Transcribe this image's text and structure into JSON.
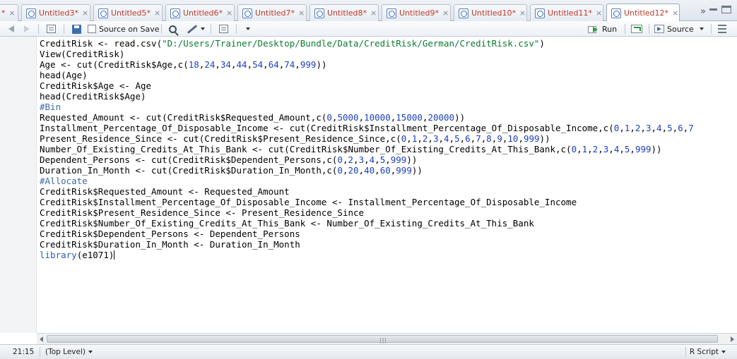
{
  "tabs": [
    {
      "label": "*",
      "close": "×"
    },
    {
      "label": "Untitled3*",
      "close": "×"
    },
    {
      "label": "Untitled5*",
      "close": "×"
    },
    {
      "label": "Untitled6*",
      "close": "×"
    },
    {
      "label": "Untitled7*",
      "close": "×"
    },
    {
      "label": "Untitled8*",
      "close": "×"
    },
    {
      "label": "Untitled9*",
      "close": "×"
    },
    {
      "label": "Untitled10*",
      "close": "×"
    },
    {
      "label": "Untitled11*",
      "close": "×"
    },
    {
      "label": "Untitled12*",
      "close": "×"
    }
  ],
  "active_tab": "Untitled12*",
  "tab_overflow": "»",
  "toolbar": {
    "source_on_save": "Source on Save",
    "run": "Run",
    "source": "Source"
  },
  "code_lines": [
    {
      "n": "1",
      "segs": [
        {
          "t": "CreditRisk <- read.csv("
        },
        {
          "t": "\"D:/Users/Trainer/Desktop/Bundle/Data/CreditRisk/German/CreditRisk.csv\"",
          "c": "st"
        },
        {
          "t": ")"
        }
      ]
    },
    {
      "n": "2",
      "segs": [
        {
          "t": "View(CreditRisk)"
        }
      ]
    },
    {
      "n": "3",
      "segs": [
        {
          "t": "Age <- cut(CreditRisk$Age,c("
        },
        {
          "t": "18",
          "c": "nm"
        },
        {
          "t": ","
        },
        {
          "t": "24",
          "c": "nm"
        },
        {
          "t": ","
        },
        {
          "t": "34",
          "c": "nm"
        },
        {
          "t": ","
        },
        {
          "t": "44",
          "c": "nm"
        },
        {
          "t": ","
        },
        {
          "t": "54",
          "c": "nm"
        },
        {
          "t": ","
        },
        {
          "t": "64",
          "c": "nm"
        },
        {
          "t": ","
        },
        {
          "t": "74",
          "c": "nm"
        },
        {
          "t": ","
        },
        {
          "t": "999",
          "c": "nm"
        },
        {
          "t": "))"
        }
      ]
    },
    {
      "n": "4",
      "segs": [
        {
          "t": "head(Age)"
        }
      ]
    },
    {
      "n": "5",
      "segs": [
        {
          "t": "CreditRisk$Age <- Age"
        }
      ]
    },
    {
      "n": "6",
      "segs": [
        {
          "t": "head(CreditRisk$Age)"
        }
      ]
    },
    {
      "n": "7",
      "segs": [
        {
          "t": "#Bin",
          "c": "cm"
        }
      ]
    },
    {
      "n": "8",
      "segs": [
        {
          "t": "Requested_Amount <- cut(CreditRisk$Requested_Amount,c("
        },
        {
          "t": "0",
          "c": "nm"
        },
        {
          "t": ","
        },
        {
          "t": "5000",
          "c": "nm"
        },
        {
          "t": ","
        },
        {
          "t": "10000",
          "c": "nm"
        },
        {
          "t": ","
        },
        {
          "t": "15000",
          "c": "nm"
        },
        {
          "t": ","
        },
        {
          "t": "20000",
          "c": "nm"
        },
        {
          "t": "))"
        }
      ]
    },
    {
      "n": "9",
      "segs": [
        {
          "t": "Installment_Percentage_Of_Disposable_Income <- cut(CreditRisk$Installment_Percentage_Of_Disposable_Income,c("
        },
        {
          "t": "0",
          "c": "nm"
        },
        {
          "t": ","
        },
        {
          "t": "1",
          "c": "nm"
        },
        {
          "t": ","
        },
        {
          "t": "2",
          "c": "nm"
        },
        {
          "t": ","
        },
        {
          "t": "3",
          "c": "nm"
        },
        {
          "t": ","
        },
        {
          "t": "4",
          "c": "nm"
        },
        {
          "t": ","
        },
        {
          "t": "5",
          "c": "nm"
        },
        {
          "t": ","
        },
        {
          "t": "6",
          "c": "nm"
        },
        {
          "t": ","
        },
        {
          "t": "7",
          "c": "nm"
        }
      ]
    },
    {
      "n": "10",
      "segs": [
        {
          "t": "Present_Residence_Since <- cut(CreditRisk$Present_Residence_Since,c("
        },
        {
          "t": "0",
          "c": "nm"
        },
        {
          "t": ","
        },
        {
          "t": "1",
          "c": "nm"
        },
        {
          "t": ","
        },
        {
          "t": "2",
          "c": "nm"
        },
        {
          "t": ","
        },
        {
          "t": "3",
          "c": "nm"
        },
        {
          "t": ","
        },
        {
          "t": "4",
          "c": "nm"
        },
        {
          "t": ","
        },
        {
          "t": "5",
          "c": "nm"
        },
        {
          "t": ","
        },
        {
          "t": "6",
          "c": "nm"
        },
        {
          "t": ","
        },
        {
          "t": "7",
          "c": "nm"
        },
        {
          "t": ","
        },
        {
          "t": "8",
          "c": "nm"
        },
        {
          "t": ","
        },
        {
          "t": "9",
          "c": "nm"
        },
        {
          "t": ","
        },
        {
          "t": "10",
          "c": "nm"
        },
        {
          "t": ","
        },
        {
          "t": "999",
          "c": "nm"
        },
        {
          "t": "))"
        }
      ]
    },
    {
      "n": "11",
      "segs": [
        {
          "t": "Number_Of_Existing_Credits_At_This_Bank <- cut(CreditRisk$Number_Of_Existing_Credits_At_This_Bank,c("
        },
        {
          "t": "0",
          "c": "nm"
        },
        {
          "t": ","
        },
        {
          "t": "1",
          "c": "nm"
        },
        {
          "t": ","
        },
        {
          "t": "2",
          "c": "nm"
        },
        {
          "t": ","
        },
        {
          "t": "3",
          "c": "nm"
        },
        {
          "t": ","
        },
        {
          "t": "4",
          "c": "nm"
        },
        {
          "t": ","
        },
        {
          "t": "5",
          "c": "nm"
        },
        {
          "t": ","
        },
        {
          "t": "999",
          "c": "nm"
        },
        {
          "t": "))"
        }
      ]
    },
    {
      "n": "12",
      "segs": [
        {
          "t": "Dependent_Persons <- cut(CreditRisk$Dependent_Persons,c("
        },
        {
          "t": "0",
          "c": "nm"
        },
        {
          "t": ","
        },
        {
          "t": "2",
          "c": "nm"
        },
        {
          "t": ","
        },
        {
          "t": "3",
          "c": "nm"
        },
        {
          "t": ","
        },
        {
          "t": "4",
          "c": "nm"
        },
        {
          "t": ","
        },
        {
          "t": "5",
          "c": "nm"
        },
        {
          "t": ","
        },
        {
          "t": "999",
          "c": "nm"
        },
        {
          "t": "))"
        }
      ]
    },
    {
      "n": "13",
      "segs": [
        {
          "t": "Duration_In_Month <- cut(CreditRisk$Duration_In_Month,c("
        },
        {
          "t": "0",
          "c": "nm"
        },
        {
          "t": ","
        },
        {
          "t": "20",
          "c": "nm"
        },
        {
          "t": ","
        },
        {
          "t": "40",
          "c": "nm"
        },
        {
          "t": ","
        },
        {
          "t": "60",
          "c": "nm"
        },
        {
          "t": ","
        },
        {
          "t": "999",
          "c": "nm"
        },
        {
          "t": "))"
        }
      ]
    },
    {
      "n": "14",
      "segs": [
        {
          "t": "#Allocate",
          "c": "cm"
        }
      ]
    },
    {
      "n": "15",
      "segs": [
        {
          "t": "CreditRisk$Requested_Amount <- Requested_Amount"
        }
      ]
    },
    {
      "n": "16",
      "segs": [
        {
          "t": "CreditRisk$Installment_Percentage_Of_Disposable_Income <- Installment_Percentage_Of_Disposable_Income"
        }
      ]
    },
    {
      "n": "17",
      "segs": [
        {
          "t": "CreditRisk$Present_Residence_Since <- Present_Residence_Since"
        }
      ]
    },
    {
      "n": "18",
      "segs": [
        {
          "t": "CreditRisk$Number_Of_Existing_Credits_At_This_Bank <- Number_Of_Existing_Credits_At_This_Bank"
        }
      ]
    },
    {
      "n": "19",
      "segs": [
        {
          "t": "CreditRisk$Dependent_Persons <- Dependent_Persons"
        }
      ]
    },
    {
      "n": "20",
      "segs": [
        {
          "t": "CreditRisk$Duration_In_Month <- Duration_In_Month"
        }
      ]
    },
    {
      "n": "21",
      "segs": [
        {
          "t": "library",
          "c": "kw"
        },
        {
          "t": "(e1071)"
        }
      ]
    }
  ],
  "status": {
    "position": "21:15",
    "scope": "(Top Level)",
    "file_type": "R Script"
  },
  "colors": {
    "tab_label": "#c0392b",
    "string": "#0b7a30",
    "number": "#1d3fbf",
    "comment": "#3c6aa5"
  },
  "icons": {
    "back": "arrow-left-icon",
    "forward": "arrow-right-icon",
    "show-in-window": "show-in-window-icon",
    "save": "save-icon",
    "search": "search-icon",
    "code-tools": "magic-wand-icon",
    "compile": "notebook-icon",
    "run": "run-icon",
    "rerun": "rerun-icon",
    "source": "source-icon",
    "outline": "outline-icon"
  }
}
